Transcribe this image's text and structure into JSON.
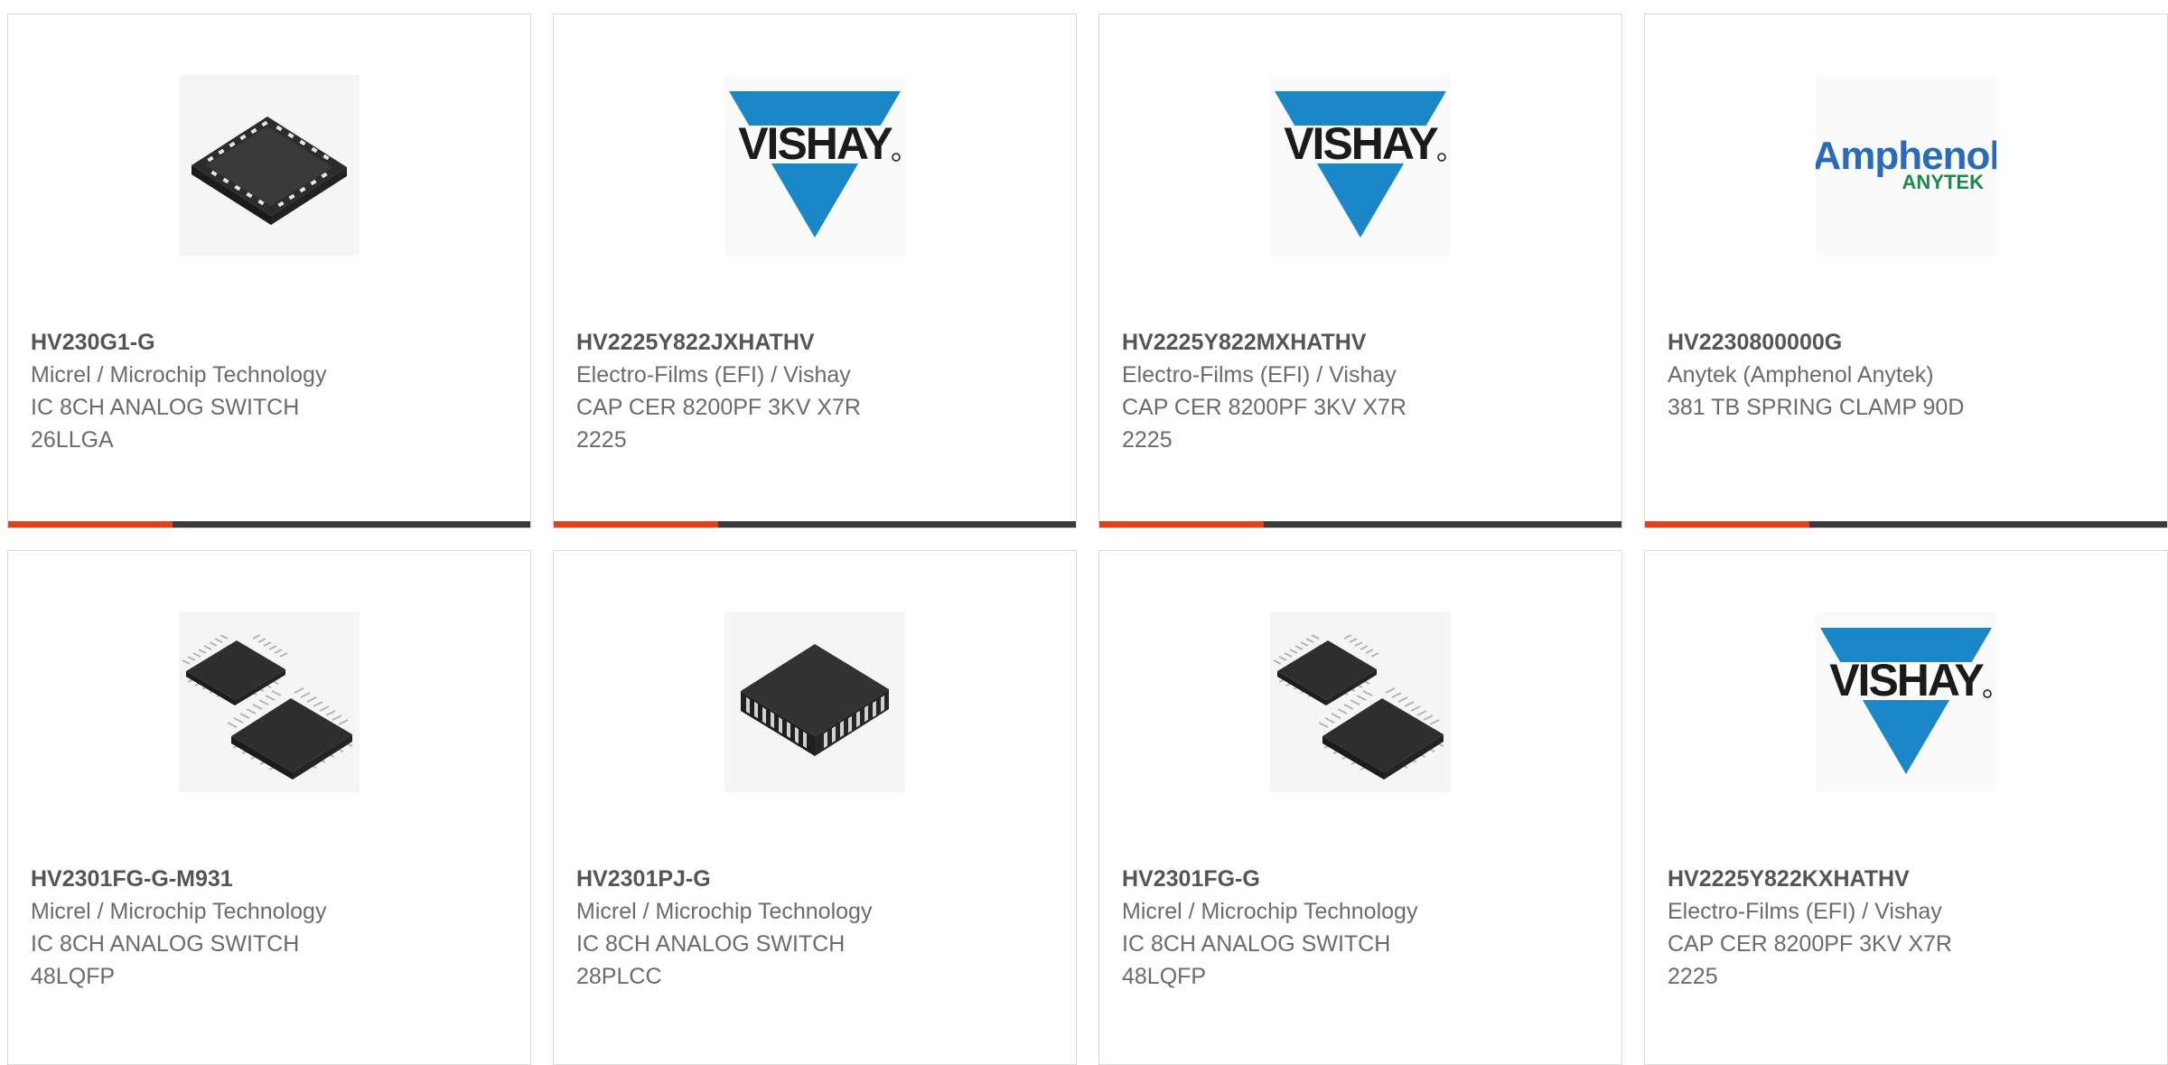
{
  "products": [
    {
      "part_number": "HV230G1-G",
      "manufacturer": "Micrel / Microchip Technology",
      "description": "IC 8CH ANALOG SWITCH\n26LLGA",
      "image": "lga-chip-image"
    },
    {
      "part_number": "HV2225Y822JXHATHV",
      "manufacturer": "Electro-Films (EFI) / Vishay",
      "description": "CAP CER 8200PF 3KV X7R\n2225",
      "image": "vishay-logo",
      "logo_text": "VISHAY"
    },
    {
      "part_number": "HV2225Y822MXHATHV",
      "manufacturer": "Electro-Films (EFI) / Vishay",
      "description": "CAP CER 8200PF 3KV X7R\n2225",
      "image": "vishay-logo",
      "logo_text": "VISHAY"
    },
    {
      "part_number": "HV2230800000G",
      "manufacturer": "Anytek (Amphenol Anytek)",
      "description": "381 TB SPRING CLAMP 90D",
      "image": "amphenol-anytek-logo",
      "logo_text": "Amphenol",
      "logo_subtext": "ANYTEK"
    },
    {
      "part_number": "HV2301FG-G-M931",
      "manufacturer": "Micrel / Microchip Technology",
      "description": "IC 8CH ANALOG SWITCH\n48LQFP",
      "image": "lqfp-chips-image"
    },
    {
      "part_number": "HV2301PJ-G",
      "manufacturer": "Micrel / Microchip Technology",
      "description": "IC 8CH ANALOG SWITCH\n28PLCC",
      "image": "plcc-chip-image"
    },
    {
      "part_number": "HV2301FG-G",
      "manufacturer": "Micrel / Microchip Technology",
      "description": "IC 8CH ANALOG SWITCH\n48LQFP",
      "image": "lqfp-chips-image"
    },
    {
      "part_number": "HV2225Y822KXHATHV",
      "manufacturer": "Electro-Films (EFI) / Vishay",
      "description": "CAP CER 8200PF 3KV X7R\n2225",
      "image": "vishay-logo",
      "logo_text": "VISHAY"
    }
  ],
  "colors": {
    "accent": "#e2411b",
    "bar_dark": "#3a3a3a",
    "vishay_blue": "#1a87c9",
    "amphenol_blue": "#2a6ab8",
    "anytek_green": "#1a8a4a"
  }
}
